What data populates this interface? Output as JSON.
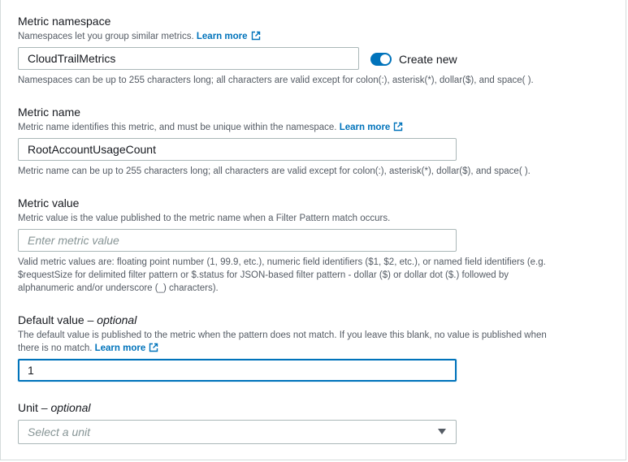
{
  "namespace": {
    "label": "Metric namespace",
    "description": "Namespaces let you group similar metrics.",
    "learn_more": "Learn more",
    "value": "CloudTrailMetrics",
    "toggle_label": "Create new",
    "toggle_on": true,
    "hint": "Namespaces can be up to 255 characters long; all characters are valid except for colon(:), asterisk(*), dollar($), and space( )."
  },
  "metric_name": {
    "label": "Metric name",
    "description": "Metric name identifies this metric, and must be unique within the namespace.",
    "learn_more": "Learn more",
    "value": "RootAccountUsageCount",
    "hint": "Metric name can be up to 255 characters long; all characters are valid except for colon(:), asterisk(*), dollar($), and space( )."
  },
  "metric_value": {
    "label": "Metric value",
    "description": "Metric value is the value published to the metric name when a Filter Pattern match occurs.",
    "placeholder": "Enter metric value",
    "hint_line1": "Valid metric values are: floating point number (1, 99.9, etc.), numeric field identifiers ($1, $2, etc.), or named field identifiers (e.g.",
    "hint_line2": "$requestSize for delimited filter pattern or $.status for JSON-based filter pattern - dollar ($) or dollar dot ($.) followed by",
    "hint_line3": "alphanumeric and/or underscore (_) characters)."
  },
  "default_value": {
    "label": "Default value",
    "optional": "– optional",
    "description_line1": "The default value is published to the metric when the pattern does not match. If you leave this blank, no value is published when",
    "description_line2": "there is no match.",
    "learn_more": "Learn more",
    "value": "1"
  },
  "unit": {
    "label": "Unit",
    "optional": "– optional",
    "placeholder": "Select a unit"
  },
  "colors": {
    "link": "#0073bb",
    "toggle": "#0073bb",
    "text": "#16191f",
    "muted": "#545b64",
    "border": "#aab7b8"
  }
}
